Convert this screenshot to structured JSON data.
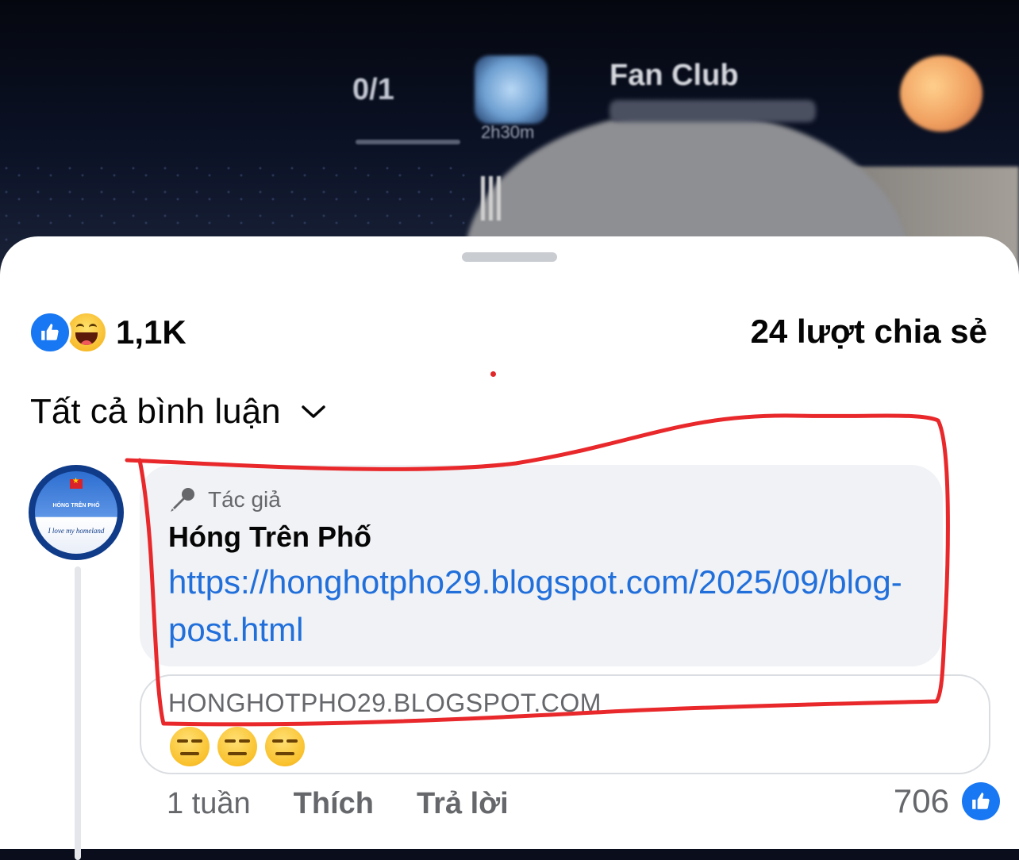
{
  "video_overlay": {
    "count_text": "0/1",
    "timer_text": "2h30m",
    "fan_club_title": "Fan Club"
  },
  "reactions": {
    "count": "1,1K",
    "types": [
      "like-icon",
      "haha-icon"
    ],
    "like_color": "#1877f2"
  },
  "shares": {
    "label": "24 lượt chia sẻ"
  },
  "comments_filter": {
    "label": "Tất cả bình luận"
  },
  "comment": {
    "author_badge": "Tác giả",
    "author_name": "Hóng Trên Phố",
    "link_text": "https://honghotpho29.blogspot.com/2025/09/blog-post.html",
    "preview_domain": "HONGHOTPHO29.BLOGSPOT.COM",
    "preview_emojis": [
      "expressionless-icon",
      "expressionless-icon",
      "expressionless-icon"
    ],
    "time": "1 tuần",
    "like_label": "Thích",
    "reply_label": "Trả lời",
    "like_count": "706",
    "link_color": "#216fdb"
  },
  "avatar": {
    "title": "HÓNG TRÊN PHỐ",
    "subtitle": "I love my homeland"
  },
  "annotation_color": "#e8282b"
}
